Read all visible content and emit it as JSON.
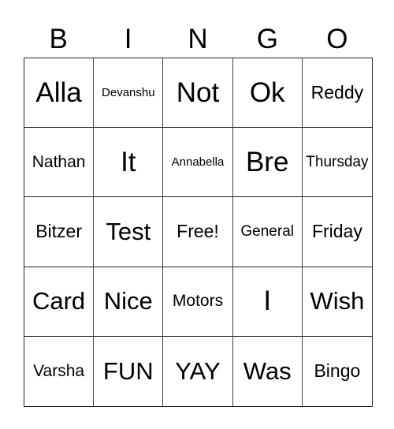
{
  "header": [
    "B",
    "I",
    "N",
    "G",
    "O"
  ],
  "cells": [
    [
      "Alla",
      "Devanshu",
      "Not",
      "Ok",
      "Reddy"
    ],
    [
      "Nathan",
      "It",
      "Annabella",
      "Bre",
      "Thursday"
    ],
    [
      "Bitzer",
      "Test",
      "Free!",
      "General",
      "Friday"
    ],
    [
      "Card",
      "Nice",
      "Motors",
      "I",
      "Wish"
    ],
    [
      "Varsha",
      "FUN",
      "YAY",
      "Was",
      "Bingo"
    ]
  ]
}
